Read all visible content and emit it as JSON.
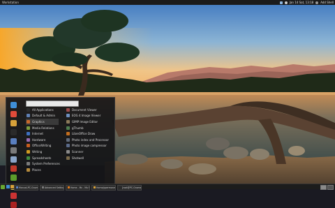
{
  "top_panel": {
    "left_text": "Workstation",
    "clock": "Jan 14 Sat, 13:18",
    "session": "Add Shell"
  },
  "app_menu": {
    "search": {
      "placeholder": ""
    },
    "categories": [
      {
        "label": "All Applications",
        "icon_color": "#2a2a2a"
      },
      {
        "label": "Default & Admin",
        "icon_color": "#5f7fb3"
      },
      {
        "label": "Graphics",
        "icon_color": "#c9682a"
      },
      {
        "label": "Media Relations",
        "icon_color": "#7d9c3d"
      },
      {
        "label": "Internet",
        "icon_color": "#3d6fbf"
      },
      {
        "label": "Hardware",
        "icon_color": "#9a6ab0"
      },
      {
        "label": "Office/Writing",
        "icon_color": "#c75c1e"
      },
      {
        "label": "Writing",
        "icon_color": "#d09a20"
      },
      {
        "label": "Spreadsheets",
        "icon_color": "#3e8a3e"
      },
      {
        "label": "System Preferences",
        "icon_color": "#7b7b7b"
      },
      {
        "label": "Places",
        "icon_color": "#b58a3c"
      }
    ],
    "selected_category_index": 2,
    "apps": [
      {
        "label": "Document Viewer",
        "icon_color": "#9c4a4a"
      },
      {
        "label": "EOG 4 Image Viewer",
        "icon_color": "#6e8fbf"
      },
      {
        "label": "GIMP Image Editor",
        "icon_color": "#8c7a5a"
      },
      {
        "label": "gThumb",
        "icon_color": "#4f7d4f"
      },
      {
        "label": "LibreOffice Draw",
        "icon_color": "#c26d1e"
      },
      {
        "label": "Photo index and Processor",
        "icon_color": "#606a7a"
      },
      {
        "label": "Photo image compressor",
        "icon_color": "#5a6a8a"
      },
      {
        "label": "Scanner",
        "icon_color": "#8a8a8a"
      },
      {
        "label": "Shotwell",
        "icon_color": "#7a6a4a"
      }
    ],
    "favorites": [
      {
        "icon": "browser-icon",
        "color": "#3f8ed8"
      },
      {
        "icon": "software-icon",
        "color": "#e04b3a"
      },
      {
        "icon": "files-icon",
        "color": "#d7a13a"
      },
      {
        "icon": "terminal-icon",
        "color": "#2a2a2a"
      },
      {
        "icon": "mail-icon",
        "color": "#5a7fbf"
      },
      {
        "icon": "settings-icon",
        "color": "#7a7a7a"
      },
      {
        "icon": "screenshot-icon",
        "color": "#8aa5c8"
      },
      {
        "icon": "calendar-icon",
        "color": "#c0392b"
      },
      {
        "icon": "system-icon",
        "color": "#5d9c2b"
      },
      {
        "icon": "lock-icon",
        "color": "#e8c84a"
      },
      {
        "icon": "logout-icon",
        "color": "#cc3333"
      },
      {
        "icon": "power-icon",
        "color": "#aa2222"
      }
    ]
  },
  "taskbar": {
    "tasks": [
      {
        "label": "Manual-PC-Gnome - Mu",
        "icon_color": "#5a7fbf"
      },
      {
        "label": "Advanced Settings",
        "icon_color": "#7a7a7a"
      },
      {
        "label": "Home - Mc - Mu Mozil",
        "icon_color": "#e07b1e"
      },
      {
        "label": "Home/ppermanent - Mo",
        "icon_color": "#d7a13a"
      },
      {
        "label": "[root@PC-Gnome] - Mo",
        "icon_color": "#2a2a2a"
      }
    ],
    "launchers": [
      {
        "icon": "browser-launcher-icon",
        "color": "#3f8ed8"
      },
      {
        "icon": "files-launcher-icon",
        "color": "#d7a13a"
      }
    ]
  },
  "colors": {
    "panel_bg": "#1b1b1b",
    "menu_bg": "#161618",
    "accent": "#6aa832"
  }
}
